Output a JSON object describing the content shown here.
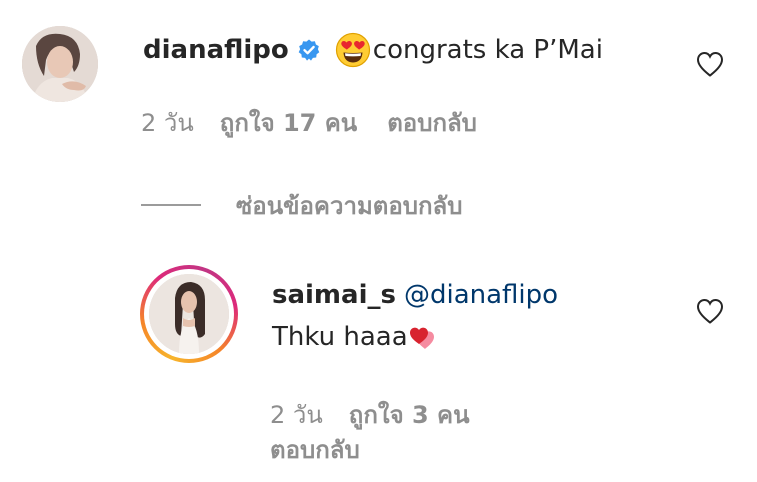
{
  "comment": {
    "username": "dianaflipo",
    "verified_icon": "verified-badge-icon",
    "emoji_icon": "heart-eyes-emoji-icon",
    "text": "congrats ka P’Mai",
    "time": "2 วัน",
    "likes": "ถูกใจ 17 คน",
    "reply_label": "ตอบกลับ",
    "like_icon": "heart-outline-icon"
  },
  "hide_replies": {
    "label": "ซ่อนข้อความตอบกลับ"
  },
  "reply": {
    "username": "saimai_s",
    "mention": "@dianaflipo",
    "text": "Thku haaa",
    "emoji_icon": "two-hearts-emoji-icon",
    "time": "2 วัน",
    "likes": "ถูกใจ 3 คน",
    "reply_label": "ตอบกลับ",
    "like_icon": "heart-outline-icon",
    "story_ring": true
  },
  "colors": {
    "text": "#262626",
    "meta": "#8e8e8e",
    "mention": "#00376b",
    "verified": "#3897f0"
  }
}
